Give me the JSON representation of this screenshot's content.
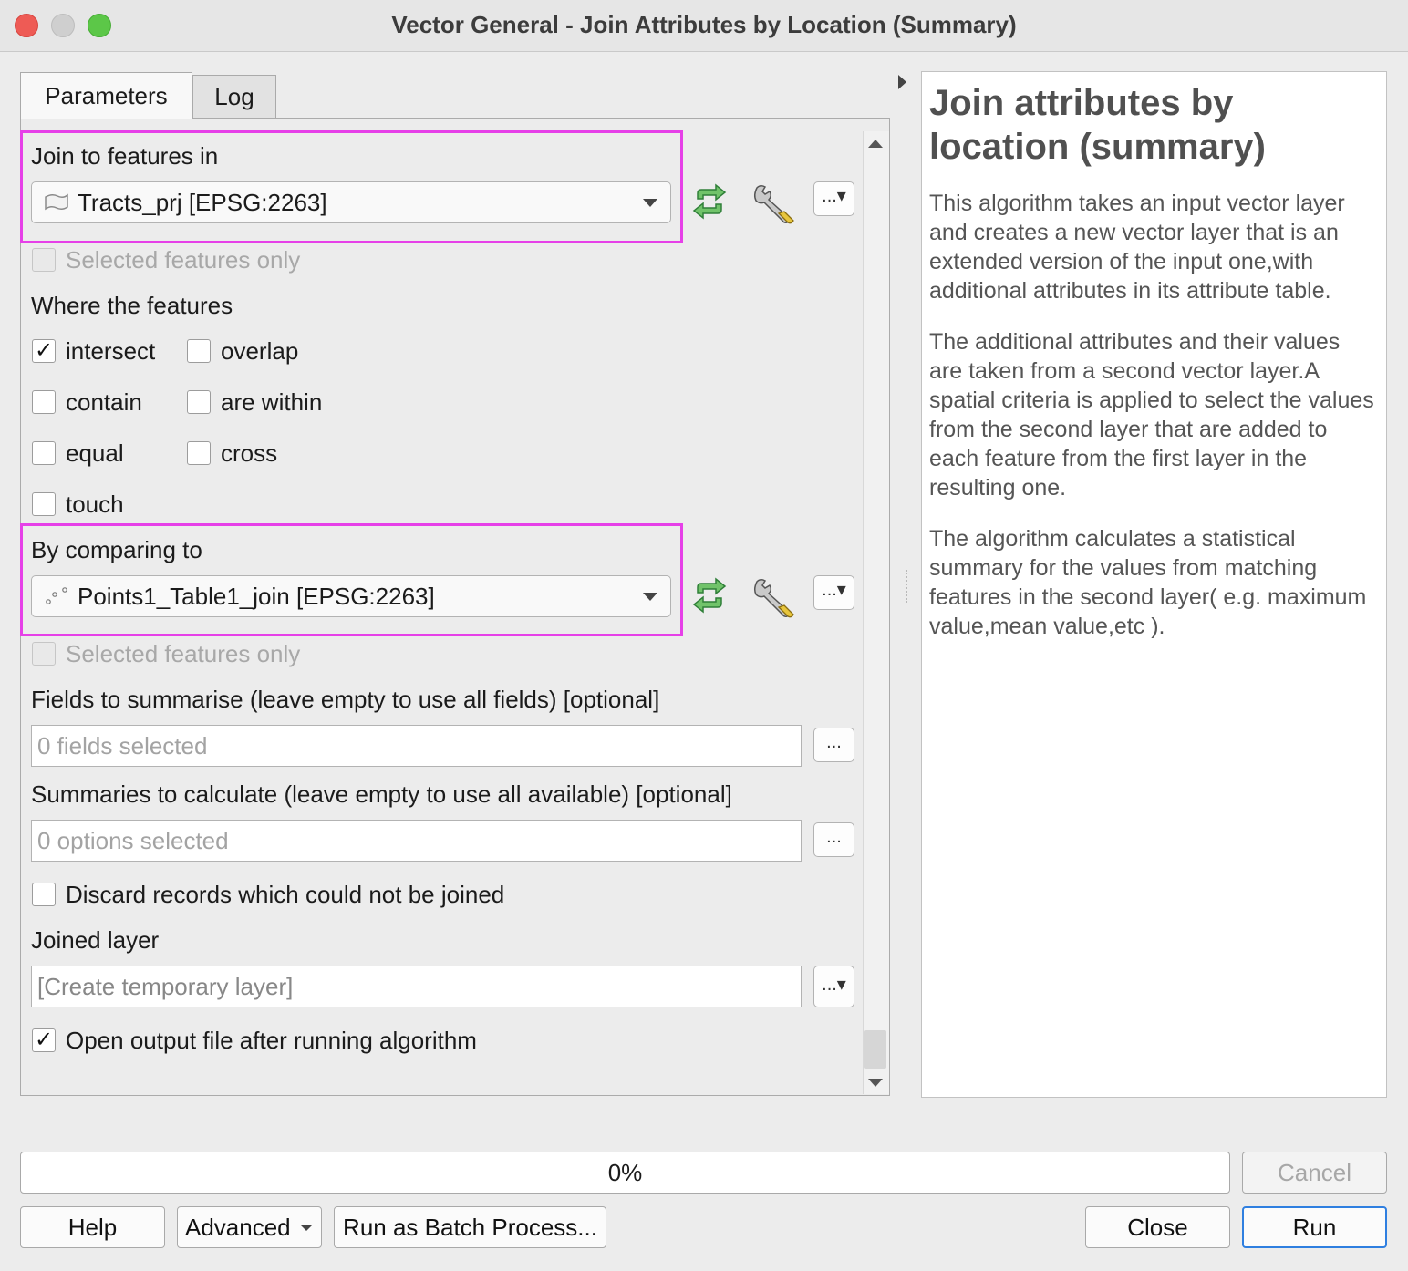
{
  "window": {
    "title": "Vector General - Join Attributes by Location (Summary)"
  },
  "tabs": [
    {
      "label": "Parameters"
    },
    {
      "label": "Log"
    }
  ],
  "params": {
    "join_label": "Join to features in",
    "join_value": "Tracts_prj [EPSG:2263]",
    "selected_only_label": "Selected features only",
    "where_label": "Where the features",
    "predicates": {
      "intersect": {
        "label": "intersect",
        "checked": "✓"
      },
      "overlap": {
        "label": "overlap",
        "checked": ""
      },
      "contain": {
        "label": "contain",
        "checked": ""
      },
      "within": {
        "label": "are within",
        "checked": ""
      },
      "equal": {
        "label": "equal",
        "checked": ""
      },
      "cross": {
        "label": "cross",
        "checked": ""
      },
      "touch": {
        "label": "touch",
        "checked": ""
      }
    },
    "compare_label": "By comparing to",
    "compare_value": "Points1_Table1_join [EPSG:2263]",
    "fields_label": "Fields to summarise (leave empty to use all fields) [optional]",
    "fields_value": "0 fields selected",
    "summaries_label": "Summaries to calculate (leave empty to use all available) [optional]",
    "summaries_value": "0 options selected",
    "discard_label": "Discard records which could not be joined",
    "joined_label": "Joined layer",
    "joined_value": "[Create temporary layer]",
    "open_output_label": "Open output file after running algorithm",
    "open_output_check": "✓",
    "ellipsis": "...",
    "ellipsis_menu": "...▾"
  },
  "help": {
    "title": "Join attributes by location (summary)",
    "p1": "This algorithm takes an input vector layer and creates a new vector layer that is an extended version of the input one,with additional attributes in its attribute table.",
    "p2": "The additional attributes and their values are taken from a second vector layer.A spatial criteria is applied to select the values from the second layer that are added to each feature from the first layer in the resulting one.",
    "p3": "The algorithm calculates a statistical summary for the values from matching features in the second layer( e.g. maximum value,mean value,etc )."
  },
  "progress": {
    "text": "0%",
    "value": 0
  },
  "buttons": {
    "cancel": "Cancel",
    "help": "Help",
    "advanced": "Advanced",
    "batch": "Run as Batch Process...",
    "close": "Close",
    "run": "Run"
  },
  "colors": {
    "highlight": "#e640e8",
    "accent": "#2f7fe0",
    "iterate_icon": "#3fa34d"
  },
  "icons": [
    "polygon-layer-icon",
    "point-layer-icon",
    "iterate-icon",
    "wrench-icon",
    "dropdown-arrow-icon",
    "collapse-arrow-icon"
  ]
}
